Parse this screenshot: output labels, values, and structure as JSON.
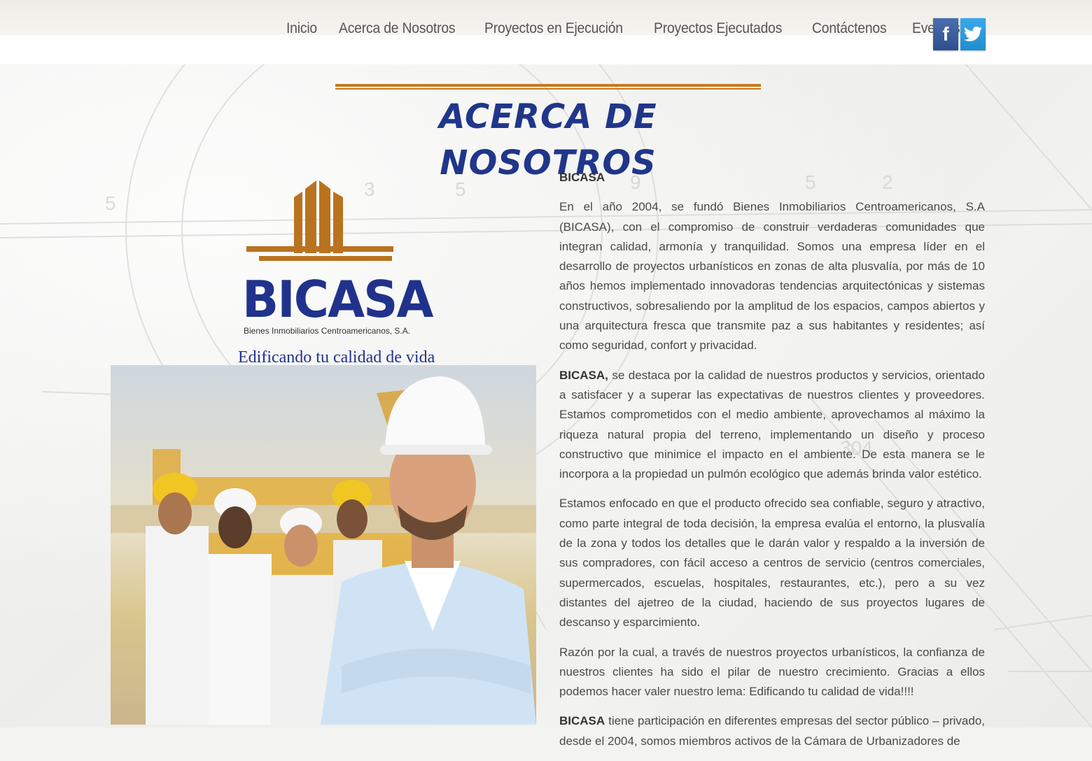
{
  "nav": {
    "items": [
      "Inicio",
      "Acerca de Nosotros",
      "Proyectos en Ejecución",
      "Proyectos Ejecutados",
      "Contáctenos",
      "Eventos"
    ]
  },
  "social": {
    "facebook_glyph": "f",
    "twitter_icon": "twitter-bird-icon",
    "facebook_color": "#3b5998",
    "twitter_color": "#2aa3e6"
  },
  "page": {
    "title": "ACERCA DE NOSOTROS",
    "accent_color": "#c77a1e",
    "title_color": "#20368a"
  },
  "logo": {
    "name": "BICASA",
    "subtitle": "Bienes Inmobiliarios Centroamericanos, S.A.",
    "slogan": "Edificando tu calidad de vida"
  },
  "content": {
    "heading": "BICASA",
    "p1": "En el año 2004, se fundó Bienes Inmobiliarios Centroamericanos, S.A (BICASA), con el compromiso de construir verdaderas comunidades que integran calidad, armonía y tranquilidad. Somos una empresa líder en el desarrollo de proyectos urbanísticos en zonas de alta plusvalía, por más de 10 años hemos implementado innovadoras tendencias arquitectónicas y sistemas constructivos, sobresaliendo por la amplitud de los espacios, campos abiertos y una arquitectura fresca que transmite paz a sus habitantes y residentes; así como seguridad, confort y privacidad.",
    "p2_brand": "BICASA,",
    "p2": " se destaca por la calidad de nuestros productos y servicios, orientado a satisfacer y a superar las expectativas de nuestros clientes y proveedores. Estamos comprometidos con el medio ambiente, aprovechamos al máximo la riqueza natural propia del terreno, implementando un diseño y proceso constructivo que minimice el impacto en el ambiente. De esta manera se le incorpora a la propiedad un pulmón ecológico que además brinda valor estético.",
    "p3": "Estamos enfocado en que el producto ofrecido sea confiable, seguro y atractivo, como parte integral de toda decisión, la empresa evalúa el entorno, la plusvalía de la zona y todos los detalles que le darán valor y respaldo a la inversión de sus compradores, con fácil acceso a centros de servicio (centros comerciales, supermercados, escuelas, hospitales, restaurantes, etc.), pero a su vez distantes del ajetreo de la ciudad, haciendo de sus proyectos lugares de descanso y esparcimiento.",
    "p4": "Razón por la cual, a través de nuestros proyectos urbanísticos, la confianza de nuestros clientes ha sido el pilar de nuestro crecimiento. Gracias a ellos podemos hacer valer nuestro lema: Edificando tu calidad de vida!!!!",
    "p5_brand": "BICASA",
    "p5": " tiene participación en diferentes empresas del sector público – privado, desde el 2004, somos miembros activos de la Cámara de Urbanizadores de"
  }
}
